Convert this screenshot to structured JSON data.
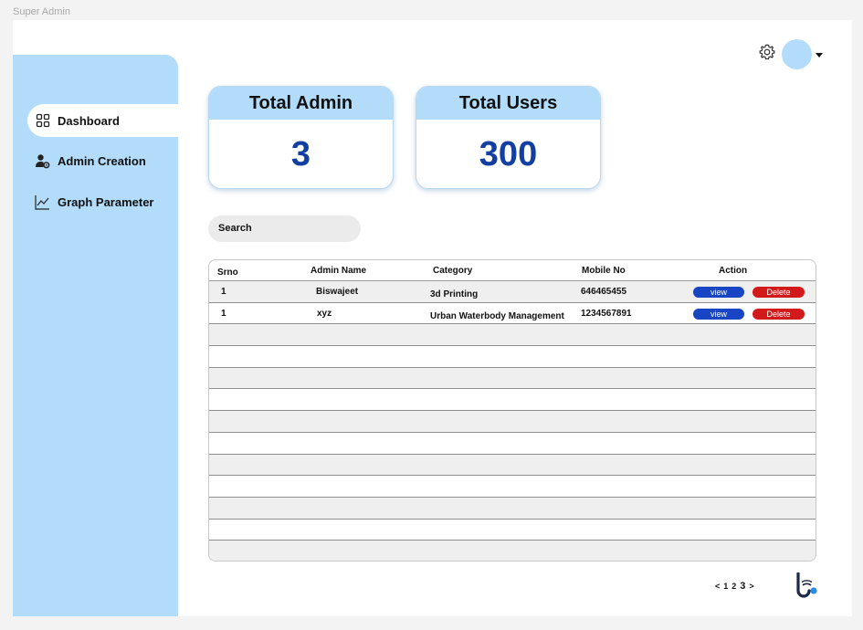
{
  "window": {
    "frame_label": "Super Admin"
  },
  "sidebar": {
    "items": [
      {
        "label": "Dashboard",
        "icon": "grid-icon",
        "active": true
      },
      {
        "label": "Admin Creation",
        "icon": "user-gear-icon",
        "active": false
      },
      {
        "label": "Graph Parameter",
        "icon": "line-chart-icon",
        "active": false
      }
    ]
  },
  "header": {
    "settings_icon": "gear-icon",
    "avatar_icon": "avatar",
    "menu_icon": "caret-down-icon"
  },
  "stats": [
    {
      "title": "Total Admin",
      "value": "3"
    },
    {
      "title": "Total Users",
      "value": "300"
    }
  ],
  "search": {
    "placeholder": "Search"
  },
  "table": {
    "columns": [
      "Srno",
      "Admin Name",
      "Category",
      "Mobile No",
      "Action"
    ],
    "rows": [
      {
        "srno": "1",
        "name": "Biswajeet",
        "category": "3d Printing",
        "mobile": "646465455"
      },
      {
        "srno": "1",
        "name": "xyz",
        "category": "Urban Waterbody Management",
        "mobile": "1234567891"
      }
    ],
    "view_label": "view",
    "delete_label": "Delete"
  },
  "pagination": {
    "prev": "<",
    "pages": [
      "1",
      "2",
      "3"
    ],
    "next": ">"
  },
  "colors": {
    "sidebar": "#b3dcfa",
    "accent": "#133fa3",
    "view": "#1745c4",
    "delete": "#d21a1a"
  }
}
